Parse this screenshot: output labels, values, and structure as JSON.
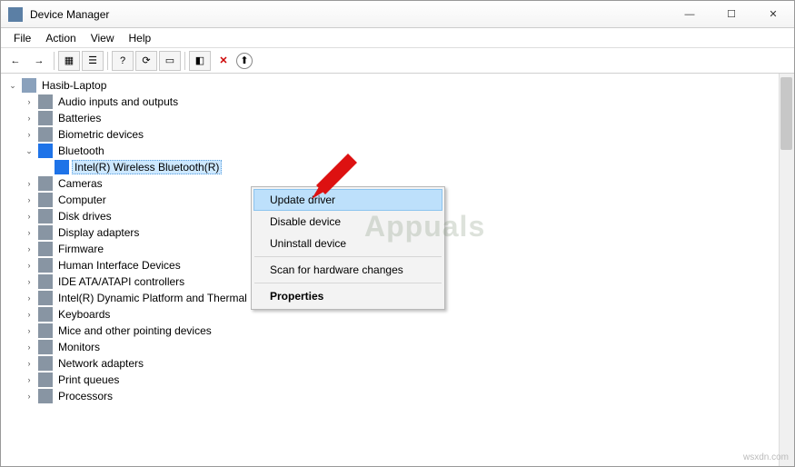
{
  "window": {
    "title": "Device Manager",
    "btn_min": "—",
    "btn_max": "☐",
    "btn_close": "✕"
  },
  "menubar": {
    "file": "File",
    "action": "Action",
    "view": "View",
    "help": "Help"
  },
  "toolbar": {
    "back": "←",
    "forward": "→",
    "up": "▦",
    "properties": "☰",
    "help": "?",
    "refresh": "⟳",
    "show": "▭",
    "scan": "◧",
    "remove": "✕",
    "updatedrv": "⬆"
  },
  "tree": {
    "root": {
      "name": "Hasib-Laptop",
      "expanded": true
    },
    "cats": [
      {
        "name": "Audio inputs and outputs"
      },
      {
        "name": "Batteries"
      },
      {
        "name": "Biometric devices"
      },
      {
        "name": "Bluetooth",
        "expanded": true,
        "children": [
          {
            "name": "Intel(R) Wireless Bluetooth(R)",
            "selected": true
          }
        ]
      },
      {
        "name": "Cameras"
      },
      {
        "name": "Computer"
      },
      {
        "name": "Disk drives"
      },
      {
        "name": "Display adapters"
      },
      {
        "name": "Firmware"
      },
      {
        "name": "Human Interface Devices"
      },
      {
        "name": "IDE ATA/ATAPI controllers"
      },
      {
        "name": "Intel(R) Dynamic Platform and Thermal Framework"
      },
      {
        "name": "Keyboards"
      },
      {
        "name": "Mice and other pointing devices"
      },
      {
        "name": "Monitors"
      },
      {
        "name": "Network adapters"
      },
      {
        "name": "Print queues"
      },
      {
        "name": "Processors"
      }
    ]
  },
  "context": {
    "update": "Update driver",
    "disable": "Disable device",
    "uninstall": "Uninstall device",
    "scan": "Scan for hardware changes",
    "props": "Properties"
  },
  "watermark": "Appuals",
  "source": "wsxdn.com"
}
